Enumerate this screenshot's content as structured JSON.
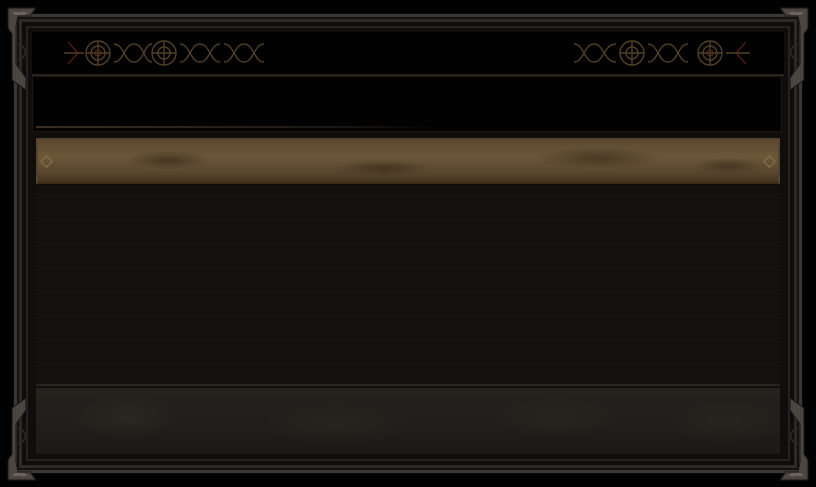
{
  "panel": {
    "title": "",
    "header_label": "",
    "content_text": ""
  },
  "colors": {
    "frame": "#3a3632",
    "leather": "#6b5738",
    "ornament_gold": "#c9a36b",
    "ornament_red": "#8a2f1e",
    "background": "#100e0c"
  },
  "icons": {
    "corner_ornament": "ornate-corner-icon",
    "header_ornament": "celtic-knot-icon"
  }
}
